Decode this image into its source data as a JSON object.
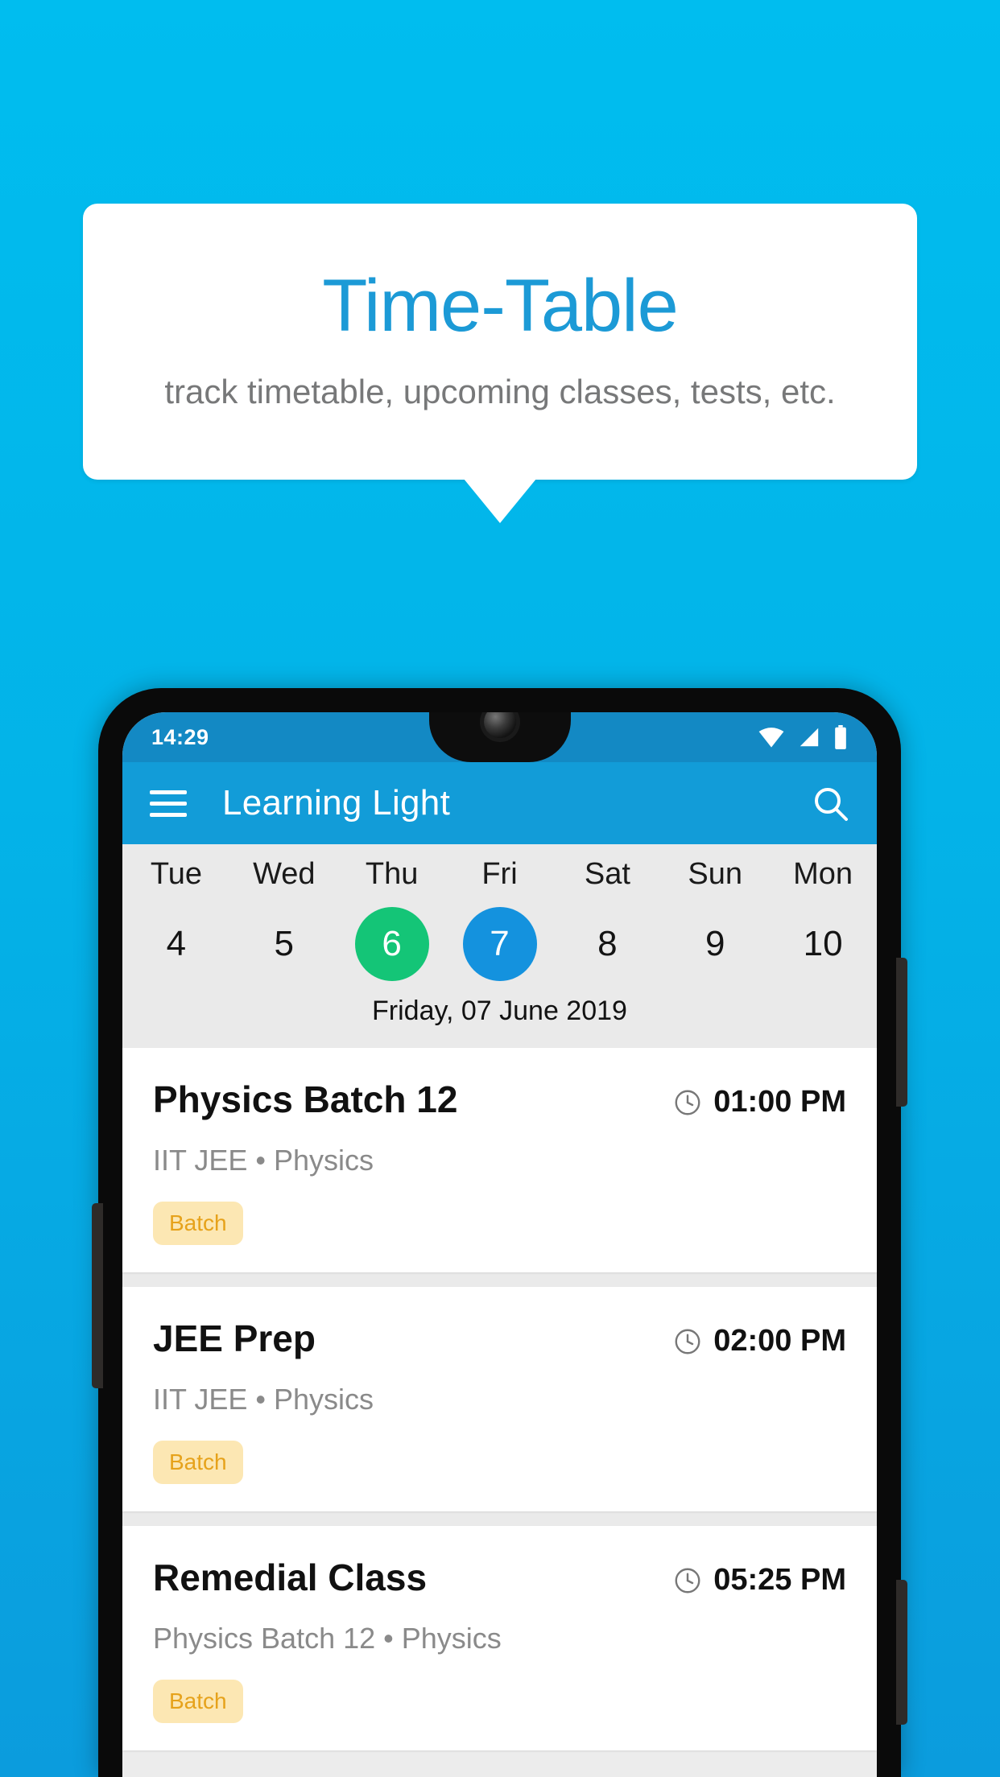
{
  "promo": {
    "title": "Time-Table",
    "subtitle": "track timetable, upcoming classes, tests, etc.",
    "title_color": "#1C9AD6",
    "background_color": "#00BDEF"
  },
  "phone": {
    "status_bar": {
      "time": "14:29",
      "icons": [
        "wifi-icon",
        "signal-icon",
        "battery-icon"
      ],
      "background_color": "#1389C4"
    },
    "app_bar": {
      "menu_label": "hamburger-menu-icon",
      "title": "Learning Light",
      "search_label": "search-icon",
      "background_color": "#129CD8"
    },
    "date_strip": {
      "days": [
        {
          "name": "Tue",
          "num": "4",
          "state": "normal"
        },
        {
          "name": "Wed",
          "num": "5",
          "state": "normal"
        },
        {
          "name": "Thu",
          "num": "6",
          "state": "today"
        },
        {
          "name": "Fri",
          "num": "7",
          "state": "selected"
        },
        {
          "name": "Sat",
          "num": "8",
          "state": "normal"
        },
        {
          "name": "Sun",
          "num": "9",
          "state": "normal"
        },
        {
          "name": "Mon",
          "num": "10",
          "state": "normal"
        }
      ],
      "today_color": "#14C577",
      "selected_color": "#1492DE",
      "date_label": "Friday, 07 June 2019"
    },
    "classes": [
      {
        "title": "Physics Batch 12",
        "time": "01:00 PM",
        "subtitle": "IIT JEE • Physics",
        "tag": "Batch"
      },
      {
        "title": "JEE Prep",
        "time": "02:00 PM",
        "subtitle": "IIT JEE • Physics",
        "tag": "Batch"
      },
      {
        "title": "Remedial Class",
        "time": "05:25 PM",
        "subtitle": "Physics Batch 12 • Physics",
        "tag": "Batch"
      }
    ],
    "tag_colors": {
      "background": "#FCE7B3",
      "text": "#E6A21B"
    }
  }
}
